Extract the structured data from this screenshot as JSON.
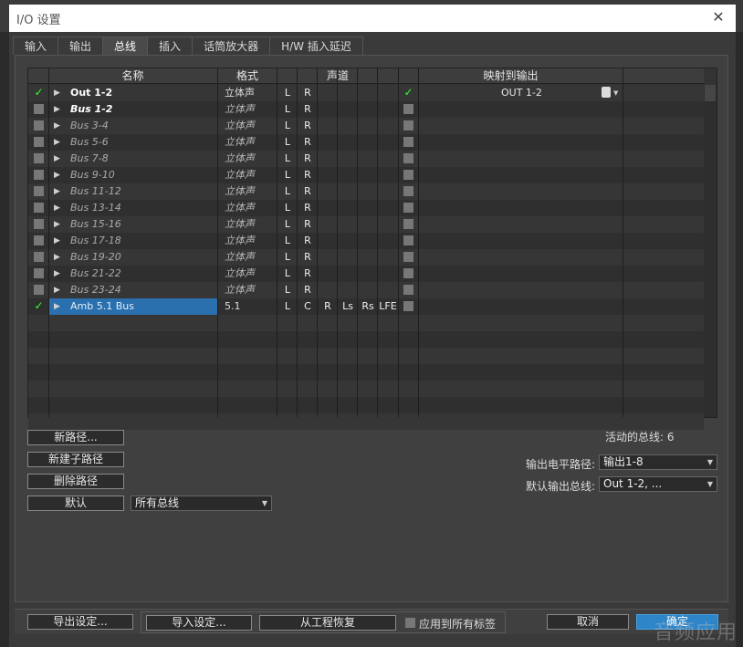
{
  "window": {
    "title": "I/O 设置",
    "close_glyph": "✕"
  },
  "tabs": [
    {
      "label": "输入",
      "active": false
    },
    {
      "label": "输出",
      "active": false
    },
    {
      "label": "总线",
      "active": true
    },
    {
      "label": "插入",
      "active": false
    },
    {
      "label": "话筒放大器",
      "active": false
    },
    {
      "label": "H/W 插入延迟",
      "active": false
    }
  ],
  "columns": {
    "name": "名称",
    "format": "格式",
    "channels": "声道",
    "mapping": "映射到输出"
  },
  "rows": [
    {
      "checked": true,
      "name": "Out 1-2",
      "style": "bold",
      "format": "立体声",
      "format_italic": false,
      "channels": [
        "L",
        "R"
      ],
      "map_checked": true,
      "map": "OUT 1-2",
      "selected": false
    },
    {
      "checked": false,
      "name": "Bus 1-2",
      "style": "bolditalic",
      "format": "立体声",
      "format_italic": true,
      "channels": [
        "L",
        "R"
      ],
      "map_checked": false,
      "map": "",
      "selected": false
    },
    {
      "checked": false,
      "name": "Bus 3-4",
      "style": "italic",
      "format": "立体声",
      "format_italic": true,
      "channels": [
        "L",
        "R"
      ],
      "map_checked": false,
      "map": "",
      "selected": false
    },
    {
      "checked": false,
      "name": "Bus 5-6",
      "style": "italic",
      "format": "立体声",
      "format_italic": true,
      "channels": [
        "L",
        "R"
      ],
      "map_checked": false,
      "map": "",
      "selected": false
    },
    {
      "checked": false,
      "name": "Bus 7-8",
      "style": "italic",
      "format": "立体声",
      "format_italic": true,
      "channels": [
        "L",
        "R"
      ],
      "map_checked": false,
      "map": "",
      "selected": false
    },
    {
      "checked": false,
      "name": "Bus 9-10",
      "style": "italic",
      "format": "立体声",
      "format_italic": true,
      "channels": [
        "L",
        "R"
      ],
      "map_checked": false,
      "map": "",
      "selected": false
    },
    {
      "checked": false,
      "name": "Bus 11-12",
      "style": "italic",
      "format": "立体声",
      "format_italic": true,
      "channels": [
        "L",
        "R"
      ],
      "map_checked": false,
      "map": "",
      "selected": false
    },
    {
      "checked": false,
      "name": "Bus 13-14",
      "style": "italic",
      "format": "立体声",
      "format_italic": true,
      "channels": [
        "L",
        "R"
      ],
      "map_checked": false,
      "map": "",
      "selected": false
    },
    {
      "checked": false,
      "name": "Bus 15-16",
      "style": "italic",
      "format": "立体声",
      "format_italic": true,
      "channels": [
        "L",
        "R"
      ],
      "map_checked": false,
      "map": "",
      "selected": false
    },
    {
      "checked": false,
      "name": "Bus 17-18",
      "style": "italic",
      "format": "立体声",
      "format_italic": true,
      "channels": [
        "L",
        "R"
      ],
      "map_checked": false,
      "map": "",
      "selected": false
    },
    {
      "checked": false,
      "name": "Bus 19-20",
      "style": "italic",
      "format": "立体声",
      "format_italic": true,
      "channels": [
        "L",
        "R"
      ],
      "map_checked": false,
      "map": "",
      "selected": false
    },
    {
      "checked": false,
      "name": "Bus 21-22",
      "style": "italic",
      "format": "立体声",
      "format_italic": true,
      "channels": [
        "L",
        "R"
      ],
      "map_checked": false,
      "map": "",
      "selected": false
    },
    {
      "checked": false,
      "name": "Bus 23-24",
      "style": "italic",
      "format": "立体声",
      "format_italic": true,
      "channels": [
        "L",
        "R"
      ],
      "map_checked": false,
      "map": "",
      "selected": false
    },
    {
      "checked": true,
      "name": "Amb 5.1 Bus",
      "style": "normal",
      "format": "5.1",
      "format_italic": false,
      "channels": [
        "L",
        "C",
        "R",
        "Ls",
        "Rs",
        "LFE"
      ],
      "map_checked": false,
      "map": "",
      "selected": true
    }
  ],
  "empty_rows": 7,
  "buttons": {
    "new_path": "新路径...",
    "new_subpath": "新建子路径",
    "delete_path": "删除路径",
    "default": "默认"
  },
  "bus_filter": {
    "value": "所有总线"
  },
  "active_buses": "活动的总线: 6",
  "meter_path": {
    "label": "输出电平路径:",
    "value": "输出1-8"
  },
  "default_output": {
    "label": "默认输出总线:",
    "value": "Out 1-2, ..."
  },
  "footer": {
    "export": "导出设定...",
    "import": "导入设定...",
    "restore": "从工程恢复",
    "apply_all": "应用到所有标签",
    "cancel": "取消",
    "ok": "确定"
  },
  "icons": {
    "check": "check-icon",
    "expand": "triangle-right-icon",
    "map_output": "speaker-icon",
    "dropdown": "chevron-down-icon"
  },
  "colors": {
    "selection": "#2a6fae",
    "check": "#33ff33",
    "ok_button": "#2e85c8"
  },
  "watermark": "音频应用"
}
